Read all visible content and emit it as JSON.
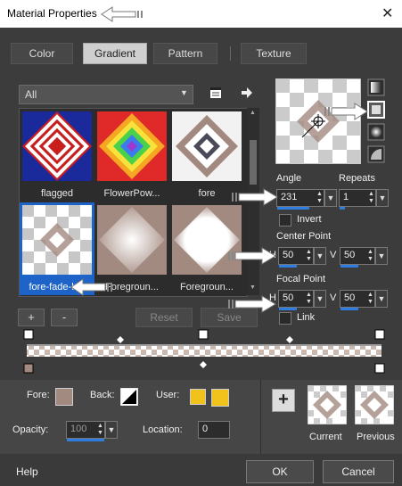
{
  "window": {
    "title": "Material Properties",
    "close_symbol": "✕"
  },
  "tabs": [
    {
      "label": "Color",
      "active": false
    },
    {
      "label": "Gradient",
      "active": true
    },
    {
      "label": "Pattern",
      "active": false
    },
    {
      "label": "Texture",
      "active": false
    }
  ],
  "gallery": {
    "category": "All",
    "items": [
      {
        "label": "flagged",
        "selected": false
      },
      {
        "label": "FlowerPow...",
        "selected": false
      },
      {
        "label": "fore",
        "selected": false
      },
      {
        "label": "fore-fade-b...",
        "selected": true
      },
      {
        "label": "Foregroun...",
        "selected": false
      },
      {
        "label": "Foregroun...",
        "selected": false
      }
    ],
    "add_label": "+",
    "remove_label": "-",
    "reset_label": "Reset",
    "save_label": "Save"
  },
  "style": {
    "angle_label": "Angle",
    "angle_value": "231",
    "repeats_label": "Repeats",
    "repeats_value": "1",
    "invert_label": "Invert",
    "center_label": "Center Point",
    "center_h": "50",
    "center_v": "50",
    "focal_label": "Focal Point",
    "focal_h": "50",
    "focal_v": "50",
    "link_label": "Link",
    "h_letter": "H",
    "v_letter": "V"
  },
  "materials": {
    "fore_label": "Fore:",
    "back_label": "Back:",
    "user_label": "User:",
    "opacity_label": "Opacity:",
    "opacity_value": "100",
    "location_label": "Location:",
    "location_value": "0",
    "add_symbol": "+",
    "current_label": "Current",
    "previous_label": "Previous",
    "user_color": "#f1c21b"
  },
  "footer": {
    "help_label": "Help",
    "ok_label": "OK",
    "cancel_label": "Cancel"
  },
  "colors": {
    "accent": "#2f7de0",
    "selection": "#1e64c8",
    "taupe": "#a38a80"
  }
}
